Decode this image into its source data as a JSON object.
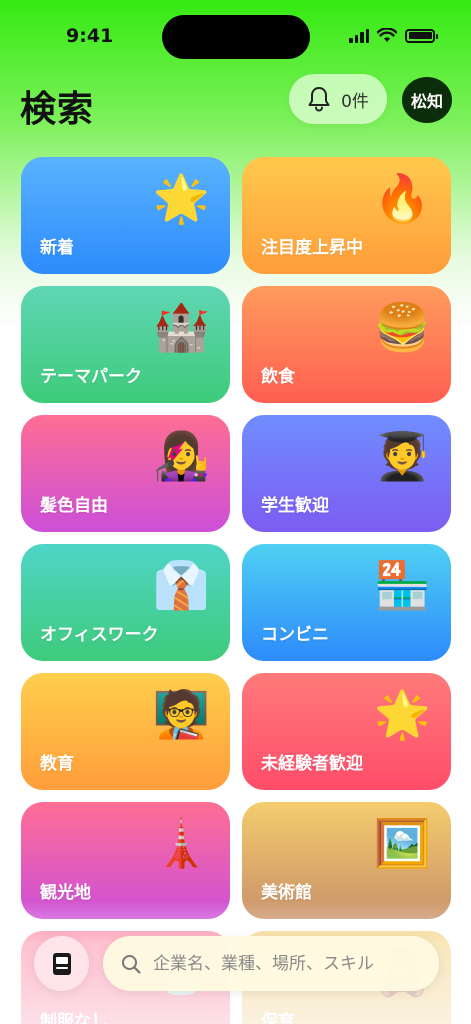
{
  "status_bar": {
    "time": "9:41"
  },
  "header": {
    "title": "検索",
    "notification_count": "0件",
    "avatar_text": "松知"
  },
  "categories": [
    {
      "label": "新着",
      "emoji": "🌟",
      "icon": "glowing-star-icon",
      "colors": [
        "#5ab3ff",
        "#2d8bfb"
      ]
    },
    {
      "label": "注目度上昇中",
      "emoji": "🔥",
      "icon": "fire-icon",
      "colors": [
        "#ffc94d",
        "#ff9d3a"
      ]
    },
    {
      "label": "テーマパーク",
      "emoji": "🏰",
      "icon": "castle-icon",
      "colors": [
        "#5fd6b4",
        "#3ecb7b"
      ]
    },
    {
      "label": "飲食",
      "emoji": "🍔",
      "icon": "hamburger-icon",
      "colors": [
        "#ff9b5c",
        "#ff5f52"
      ]
    },
    {
      "label": "髪色自由",
      "emoji": "👩‍🎤",
      "icon": "singer-icon",
      "colors": [
        "#ff6e94",
        "#cc4fd9"
      ]
    },
    {
      "label": "学生歓迎",
      "emoji": "🧑‍🎓",
      "icon": "student-icon",
      "colors": [
        "#6f8dff",
        "#7d5cf2"
      ]
    },
    {
      "label": "オフィスワーク",
      "emoji": "👔",
      "icon": "necktie-icon",
      "colors": [
        "#4fd5c7",
        "#3ecb7b"
      ]
    },
    {
      "label": "コンビニ",
      "emoji": "🏪",
      "icon": "convenience-store-icon",
      "colors": [
        "#4fd0f3",
        "#2d8bfb"
      ]
    },
    {
      "label": "教育",
      "emoji": "🧑‍🏫",
      "icon": "teacher-icon",
      "colors": [
        "#ffcf4d",
        "#ff9d3a"
      ]
    },
    {
      "label": "未経験者歓迎",
      "emoji": "🌟",
      "icon": "glowing-star-icon",
      "colors": [
        "#ff7a7a",
        "#ff4d6a"
      ]
    },
    {
      "label": "観光地",
      "emoji": "🗼",
      "icon": "tokyo-tower-icon",
      "colors": [
        "#ff6e94",
        "#cc4fd9"
      ]
    },
    {
      "label": "美術館",
      "emoji": "🖼️",
      "icon": "framed-picture-icon",
      "colors": [
        "#f4cc6e",
        "#c9926a"
      ]
    },
    {
      "label": "制服なし",
      "emoji": "👕",
      "icon": "t-shirt-icon",
      "colors": [
        "#ff7a9a",
        "#f45f86"
      ]
    },
    {
      "label": "保育",
      "emoji": "🧸",
      "icon": "teddy-bear-icon",
      "colors": [
        "#f4cc6e",
        "#e7b85c"
      ]
    }
  ],
  "bottom_bar": {
    "search_placeholder": "企業名、業種、場所、スキル"
  }
}
